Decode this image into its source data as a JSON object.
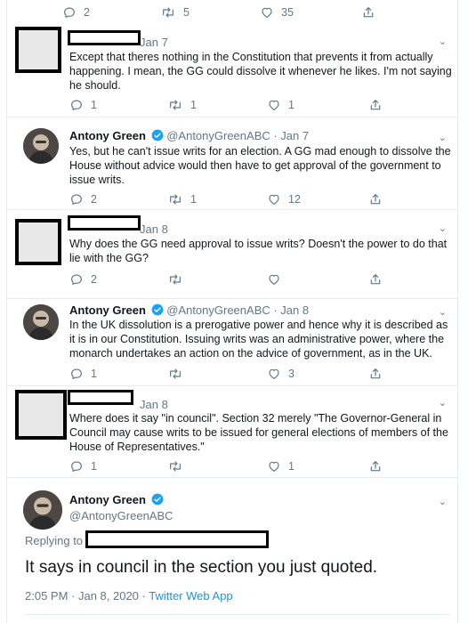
{
  "colors": {
    "accent": "#1da1f2",
    "muted": "#657786",
    "text": "#14171a",
    "border": "#e6ecf0"
  },
  "icons": [
    "reply-icon",
    "retweet-icon",
    "like-icon",
    "share-icon",
    "chevron-down-icon",
    "verified-badge-icon"
  ],
  "top_actions": {
    "reply_count": "2",
    "retweet_count": "5",
    "like_count": "35"
  },
  "tweets": [
    {
      "date": "Jan 7",
      "text": "Except that theres nothing in the Constitution that prevents it from actually happening. I mean, the GG could dissolve it whenever he likes. I'm not saying he should.",
      "reply_count": "1",
      "retweet_count": "1",
      "like_count": "1"
    },
    {
      "name": "Antony Green",
      "handle_date": "@AntonyGreenABC · Jan 7",
      "text": "Yes, but he can't issue writs for an election. A GG mad enough to dissolve the House without advice would then have to get approval of the government to issue writs.",
      "reply_count": "2",
      "retweet_count": "1",
      "like_count": "12"
    },
    {
      "date": "Jan 8",
      "text": "Why does the GG need approval to issue writs? Doesn't the power to do that lie with the GG?",
      "reply_count": "2",
      "retweet_count": "",
      "like_count": ""
    },
    {
      "name": "Antony Green",
      "handle_date": "@AntonyGreenABC · Jan 8",
      "text": "In the UK dissolution is a prerogative power and hence why it is described as it is in our Constitution. Issuing writs was an administrative power, where the monarch undertakes an action on the advice of government, as in the UK.",
      "reply_count": "1",
      "retweet_count": "",
      "like_count": "3"
    },
    {
      "date": "Jan 8",
      "text": "Where does it say \"in council\". Section 32 merely \"The Governor-General in Council may cause writs to be issued for general elections of members of the House of Representatives.\"",
      "reply_count": "1",
      "retweet_count": "",
      "like_count": "1"
    }
  ],
  "main_tweet": {
    "name": "Antony Green",
    "handle": "@AntonyGreenABC",
    "replying_to": "Replying to",
    "text": "It says in council in the section you just quoted.",
    "timestamp": "2:05 PM · Jan 8, 2020 · ",
    "source_app": "Twitter Web App"
  }
}
